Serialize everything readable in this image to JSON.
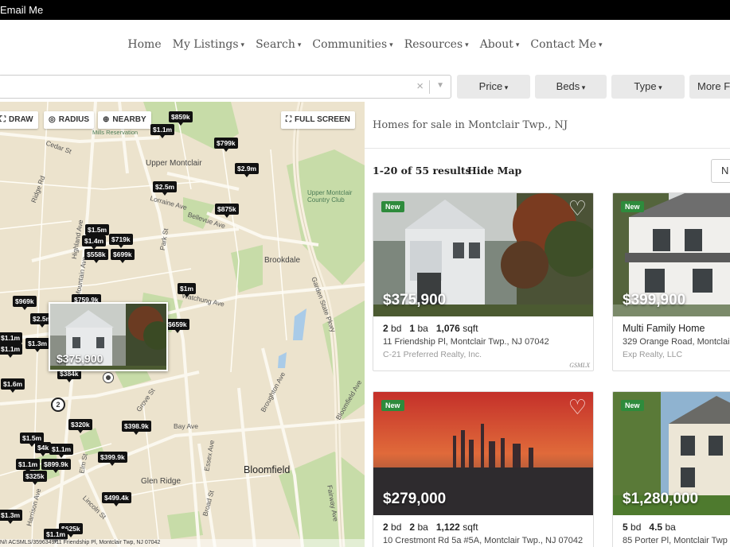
{
  "topbar": {
    "text": "Email Me"
  },
  "nav": {
    "items": [
      {
        "label": "Home",
        "dropdown": false
      },
      {
        "label": "My Listings",
        "dropdown": true
      },
      {
        "label": "Search",
        "dropdown": true
      },
      {
        "label": "Communities",
        "dropdown": true
      },
      {
        "label": "Resources",
        "dropdown": true
      },
      {
        "label": "About",
        "dropdown": true
      },
      {
        "label": "Contact Me",
        "dropdown": true
      }
    ]
  },
  "filters": {
    "search": {
      "value": "",
      "clear": "×"
    },
    "price": "Price",
    "beds": "Beds",
    "type": "Type",
    "more": "More Fi"
  },
  "map": {
    "tools": {
      "draw": "DRAW",
      "radius": "RADIUS",
      "nearby": "NEARBY",
      "fullscreen": "FULL SCREEN"
    },
    "places": [
      "Upper Montclair",
      "Brookdale",
      "Bloomfield",
      "Glen Ridge",
      "Upper Montclair Country Club",
      "Mills Reservation"
    ],
    "roads": [
      "Cedar St",
      "Ridge Rd",
      "Bellevue Ave",
      "Park St",
      "Watchung Ave",
      "Grove St",
      "Bay Ave",
      "Broughton Ave",
      "Garden State Pkwy",
      "Broad St",
      "Essex Ave",
      "Elm St",
      "Lincoln St",
      "Mountain Ave",
      "Highland Ave",
      "Harrison Ave",
      "Fairway Ave",
      "Bloomfield Ave",
      "Lorraine Ave"
    ],
    "pins": [
      "$859k",
      "$1.1m",
      "$799k",
      "$2.9m",
      "$2.5m",
      "$875k",
      "$1.5m",
      "$1.4m",
      "$719k",
      "$558k",
      "$699k",
      "$1m",
      "$969k",
      "$759.9k",
      "$2.5m",
      "$659k",
      "$1.1m",
      "$1.3m",
      "$1.1m",
      "$384k",
      "$1.6m",
      "$320k",
      "$398.9k",
      "$1.5m",
      "$4k",
      "$1.1m",
      "$1.1m",
      "$899.9k",
      "$399.9k",
      "$325k",
      "$499.4k",
      "$1.3m",
      "$625k",
      "$1.1m"
    ],
    "popup_price": "$375,900",
    "cluster": "2",
    "footer": "N/I ACSMLS/3596349/11 Friendship Pl, Montclair Twp, NJ 07042"
  },
  "results": {
    "heading": "Homes for sale in Montclair Twp., NJ",
    "count": "1-20 of 55 results",
    "hide_map": "Hide Map",
    "sort": "N",
    "cards": [
      {
        "badge": "New",
        "price": "$375,900",
        "beds": "2",
        "baths": "1",
        "sqft": "1,076",
        "bd": "bd",
        "ba": "ba",
        "sqft_label": "sqft",
        "address": "11 Friendship Pl, Montclair Twp., NJ 07042",
        "broker": "C-21 Preferred Realty, Inc.",
        "source": "GSMLX"
      },
      {
        "badge": "New",
        "price": "$399,900",
        "type": "Multi Family Home",
        "address": "329 Orange Road, Montclair",
        "broker": "Exp Realty, LLC"
      },
      {
        "badge": "New",
        "price": "$279,000",
        "beds": "2",
        "baths": "2",
        "sqft": "1,122",
        "bd": "bd",
        "ba": "ba",
        "sqft_label": "sqft",
        "address": "10 Crestmont Rd 5a #5A, Montclair Twp., NJ 07042"
      },
      {
        "badge": "New",
        "price": "$1,280,000",
        "beds": "5",
        "baths": "4.5",
        "bd": "bd",
        "ba": "ba",
        "address": "85 Porter Pl, Montclair Twp"
      }
    ]
  }
}
